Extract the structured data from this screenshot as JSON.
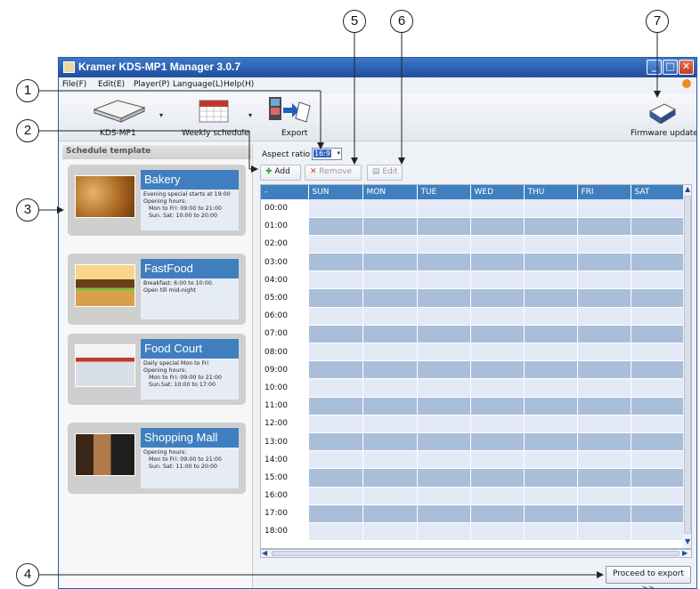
{
  "window": {
    "title": "Kramer KDS-MP1 Manager 3.0.7",
    "controls": {
      "minimize": "_",
      "maximize": "□",
      "close": "✕"
    }
  },
  "menu": [
    "File(F)",
    "Edit(E)",
    "Player(P)",
    "Language(L)",
    "Help(H)"
  ],
  "toolbar": {
    "device_label": "KDS-MP1",
    "weekly_label": "Weekly schedule",
    "export_label": "Export",
    "firmware_label": "Firmware update",
    "dropdown_glyph": "▾"
  },
  "left_panel": {
    "header": "Schedule template",
    "templates": [
      {
        "title": "Bakery",
        "lines": [
          "Evening special starts at 19:00",
          "Opening hours:",
          "Mon to Fri: 09:00 to 21:00",
          "Sun. Sat: 10:00 to 20:00"
        ]
      },
      {
        "title": "FastFood",
        "lines": [
          "Breakfast: 6:00 to 10:00.",
          "Open till mid-night",
          "",
          ""
        ]
      },
      {
        "title": "Food Court",
        "lines": [
          "Daily special Mon to Fri",
          "Opening hours:",
          "Mon to Fri: 09:00 to 21:00",
          "Sun.Sat: 10:00 to 17:00"
        ]
      },
      {
        "title": "Shopping Mall",
        "lines": [
          "Opening hours:",
          "Mon to Fri: 09:00 to 21:00",
          "Sun. Sat: 11:00 to 20:00",
          ""
        ]
      }
    ]
  },
  "schedule": {
    "aspect_label": "Aspect ratio",
    "aspect_value": "16:9",
    "aspect_arrow": "▾",
    "add_label": "Add",
    "remove_label": "Remove",
    "edit_label": "Edit",
    "columns": [
      "-",
      "SUN",
      "MON",
      "TUE",
      "WED",
      "THU",
      "FRI",
      "SAT"
    ],
    "times": [
      "00:00",
      "01:00",
      "02:00",
      "03:00",
      "04:00",
      "05:00",
      "06:00",
      "07:00",
      "08:00",
      "09:00",
      "10:00",
      "11:00",
      "12:00",
      "13:00",
      "14:00",
      "15:00",
      "16:00",
      "17:00",
      "18:00"
    ],
    "scroll": {
      "up": "▲",
      "down": "▼",
      "left": "◀",
      "right": "▶"
    },
    "proceed_label": "Proceed to export >>"
  },
  "callouts": [
    "1",
    "2",
    "3",
    "4",
    "5",
    "6",
    "7"
  ],
  "colors": {
    "accent": "#3f7fbf",
    "titlebar": "#1f4e9e",
    "row_light": "#e4e9f6",
    "row_dark": "#a9bed8",
    "card_bg": "#cfcfcf"
  }
}
